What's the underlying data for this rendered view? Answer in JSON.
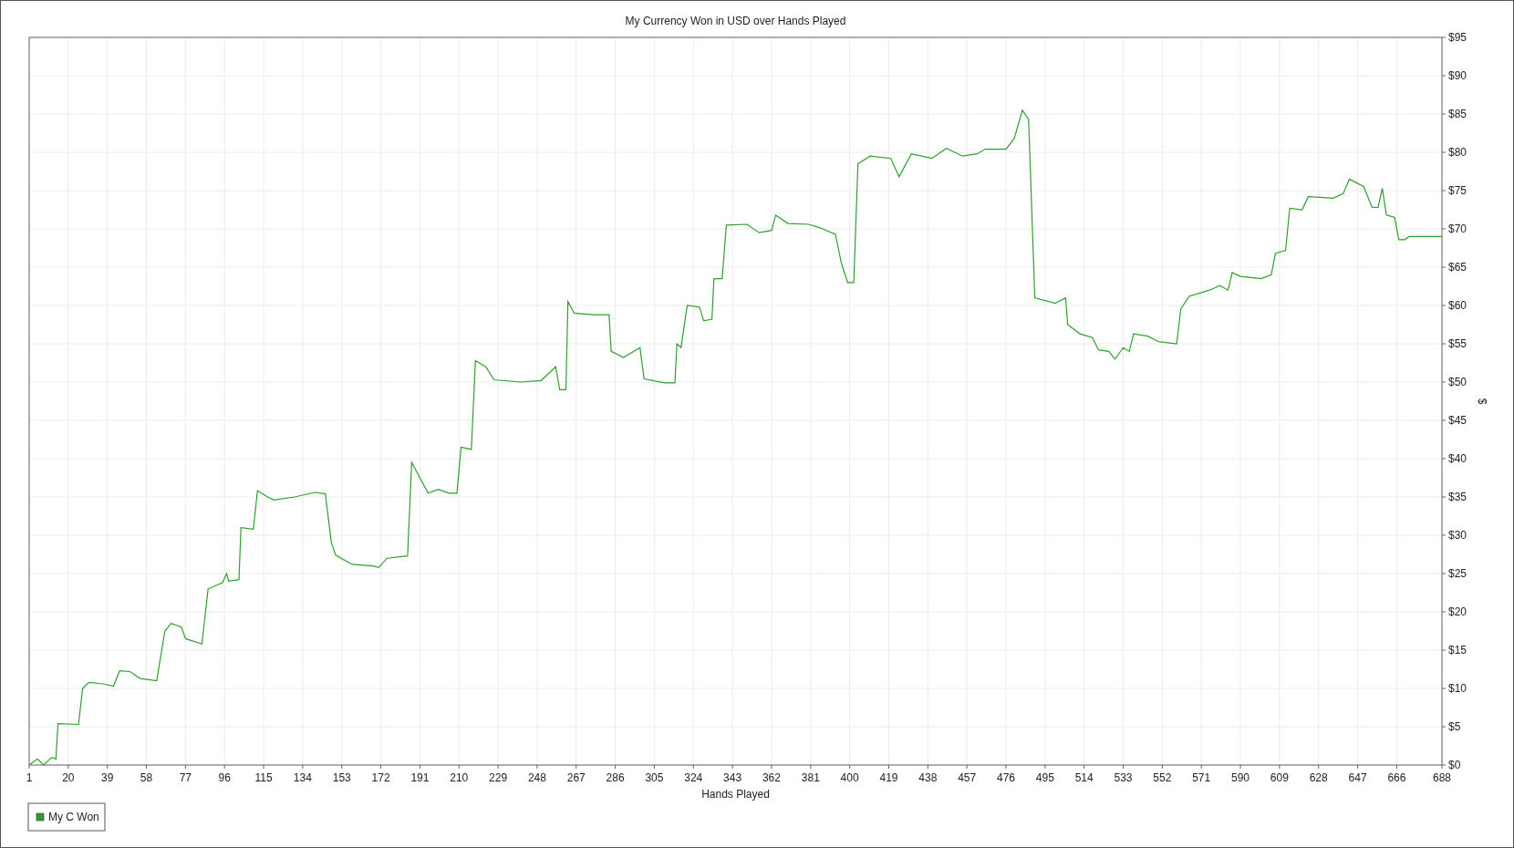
{
  "chart": {
    "chart_data": {
      "type": "line",
      "grid": true,
      "title": "My Currency Won in USD over Hands Played",
      "xlabel": "Hands Played",
      "ylabel": "$",
      "xlim": [
        1,
        688
      ],
      "ylim": [
        0,
        95
      ],
      "xticks": [
        1,
        20,
        39,
        58,
        77,
        96,
        115,
        134,
        153,
        172,
        191,
        210,
        229,
        248,
        267,
        286,
        305,
        324,
        343,
        362,
        381,
        400,
        419,
        438,
        457,
        476,
        495,
        514,
        533,
        552,
        571,
        590,
        609,
        628,
        647,
        666,
        688
      ],
      "yticks": [
        {
          "value": 0,
          "label": "$0"
        },
        {
          "value": 5,
          "label": "$5"
        },
        {
          "value": 10,
          "label": "$10"
        },
        {
          "value": 15,
          "label": "$15"
        },
        {
          "value": 20,
          "label": "$20"
        },
        {
          "value": 25,
          "label": "$25"
        },
        {
          "value": 30,
          "label": "$30"
        },
        {
          "value": 35,
          "label": "$35"
        },
        {
          "value": 40,
          "label": "$40"
        },
        {
          "value": 45,
          "label": "$45"
        },
        {
          "value": 50,
          "label": "$50"
        },
        {
          "value": 55,
          "label": "$55"
        },
        {
          "value": 60,
          "label": "$60"
        },
        {
          "value": 65,
          "label": "$65"
        },
        {
          "value": 70,
          "label": "$70"
        },
        {
          "value": 75,
          "label": "$75"
        },
        {
          "value": 80,
          "label": "$80"
        },
        {
          "value": 85,
          "label": "$85"
        },
        {
          "value": 90,
          "label": "$90"
        },
        {
          "value": 95,
          "label": "$95"
        }
      ],
      "x": [
        1,
        5,
        8,
        12,
        14,
        15,
        25,
        27,
        30,
        37,
        42,
        45,
        50,
        55,
        63,
        67,
        70,
        75,
        77,
        85,
        88,
        95,
        97,
        98,
        103,
        104,
        110,
        112,
        117,
        120,
        130,
        140,
        145,
        148,
        150,
        158,
        168,
        171,
        175,
        185,
        187,
        190,
        195,
        200,
        205,
        209,
        211,
        216,
        218,
        223,
        227,
        240,
        250,
        257,
        259,
        262,
        263,
        266,
        275,
        283,
        284,
        290,
        298,
        300,
        310,
        315,
        316,
        318,
        321,
        327,
        329,
        333,
        334,
        338,
        340,
        350,
        356,
        362,
        364,
        370,
        380,
        385,
        393,
        396,
        399,
        402,
        404,
        410,
        420,
        424,
        430,
        440,
        447,
        455,
        462,
        466,
        476,
        480,
        484,
        487,
        490,
        500,
        505,
        506,
        512,
        518,
        521,
        526,
        529,
        533,
        536,
        538,
        545,
        550,
        559,
        561,
        565,
        575,
        580,
        584,
        586,
        590,
        600,
        605,
        607,
        612,
        614,
        620,
        623,
        635,
        640,
        643,
        650,
        654,
        657,
        659,
        661,
        665,
        667,
        670,
        672,
        688
      ],
      "series": [
        {
          "name": "My C Won",
          "color": "#2ca02c",
          "values": [
            0,
            0.8,
            0,
            1,
            0.8,
            5.4,
            5.3,
            10,
            10.8,
            10.6,
            10.3,
            12.3,
            12.2,
            11.3,
            11,
            17.5,
            18.5,
            18,
            16.5,
            15.8,
            23,
            23.8,
            25,
            24,
            24.2,
            31,
            30.8,
            35.8,
            35,
            34.6,
            35,
            35.6,
            35.4,
            29,
            27.4,
            26.2,
            26,
            25.8,
            27,
            27.3,
            39.5,
            38,
            35.5,
            36,
            35.5,
            35.5,
            41.5,
            41.2,
            52.8,
            52,
            50.3,
            50,
            50.2,
            52,
            49,
            49,
            60.5,
            59,
            58.8,
            58.8,
            54,
            53.2,
            54.5,
            50.4,
            49.9,
            49.9,
            55,
            54.5,
            60,
            59.8,
            58,
            58.2,
            63.5,
            63.5,
            70.5,
            70.6,
            69.5,
            69.8,
            71.8,
            70.7,
            70.6,
            70.2,
            69.3,
            65.5,
            63,
            63,
            78.5,
            79.5,
            79.2,
            76.8,
            79.8,
            79.2,
            80.5,
            79.5,
            79.8,
            80.4,
            80.4,
            81.8,
            85.5,
            84.3,
            61,
            60.3,
            61,
            57.5,
            56.3,
            55.8,
            54.2,
            54,
            53,
            54.5,
            54,
            56.3,
            56,
            55.3,
            55,
            59.5,
            61.2,
            62,
            62.6,
            62,
            64.3,
            63.8,
            63.5,
            64,
            66.8,
            67.2,
            72.7,
            72.5,
            74.2,
            74,
            74.6,
            76.5,
            75.5,
            72.8,
            72.8,
            75.3,
            71.8,
            71.5,
            68.6,
            68.6,
            69,
            69
          ]
        }
      ]
    }
  }
}
